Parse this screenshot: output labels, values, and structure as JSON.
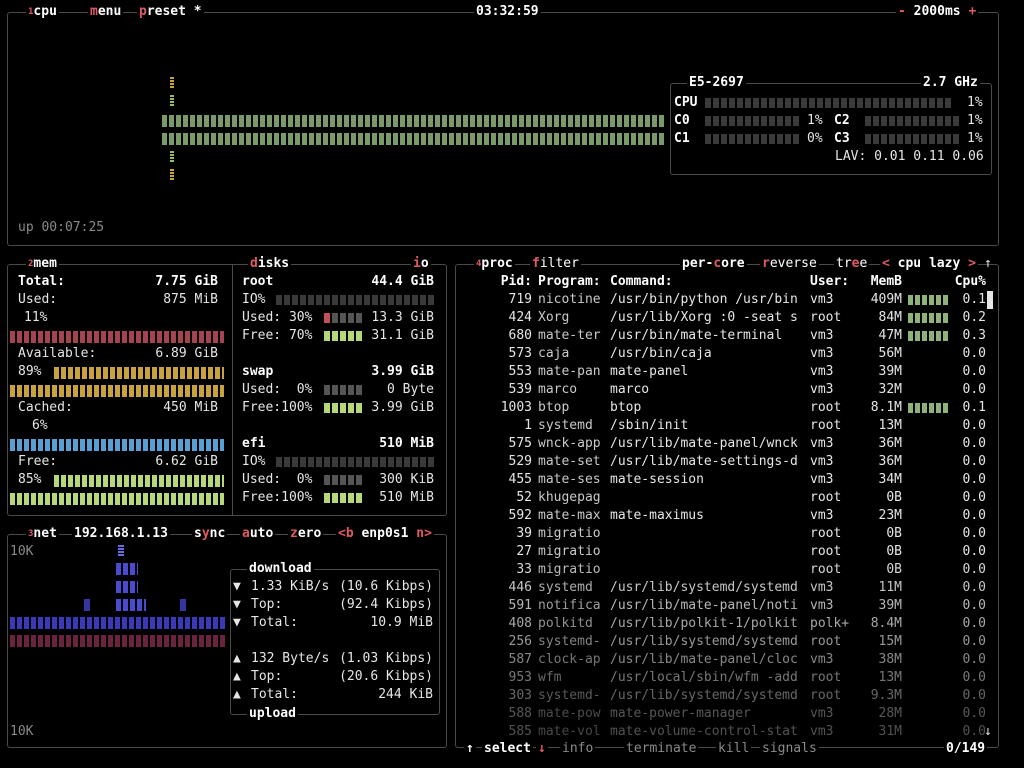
{
  "colors": {
    "accent": "#e05a63",
    "green_dim": "#4c6b3c",
    "green": "#7ab55c",
    "mem_used": "#c0505e",
    "mem_avail": "#c8a23c",
    "mem_cached": "#5a9fd4",
    "mem_free": "#9fd05a",
    "net_dl": "#4b4bd0",
    "net_ul": "#8a2c4a"
  },
  "cpu_box": {
    "title": "cpu",
    "menu": "menu",
    "preset": "preset *",
    "clock": "03:32:59",
    "refresh": "2000ms",
    "minus": "-",
    "plus": "+",
    "uptime": "up 00:07:25",
    "model": "E5-2697",
    "freq": "2.7 GHz",
    "total": {
      "label": "CPU",
      "value": "1%"
    },
    "cores": [
      {
        "label": "C0",
        "value": "1%"
      },
      {
        "label": "C1",
        "value": "0%"
      },
      {
        "label": "C2",
        "value": "1%"
      },
      {
        "label": "C3",
        "value": "1%"
      }
    ],
    "lav_label": "LAV:",
    "lav": "0.01 0.11 0.06",
    "superscript": "1"
  },
  "mem_box": {
    "title": "mem",
    "superscript": "2",
    "total_label": "Total:",
    "total": "7.75 GiB",
    "used_label": "Used:",
    "used": "875 MiB",
    "used_pct": "11%",
    "available_label": "Available:",
    "available": "6.89 GiB",
    "available_pct": "89%",
    "cached_label": "Cached:",
    "cached": "450 MiB",
    "cached_pct": "6%",
    "free_label": "Free:",
    "free": "6.62 GiB",
    "free_pct": "85%",
    "levels": {
      "used": 0.11,
      "available": 0.89,
      "cached": 0.06,
      "free": 0.85
    }
  },
  "disks_box": {
    "title": "disks",
    "io": "io",
    "disks": [
      {
        "name": "root",
        "size": "44.4 GiB",
        "io_label": "IO%",
        "used_label": "Used: 30%",
        "used": "13.3 GiB",
        "free_label": "Free: 70%",
        "free": "31.1 GiB"
      },
      {
        "name": "swap",
        "size": "3.99 GiB",
        "used_label": "Used:  0%",
        "used": "0 Byte",
        "free_label": "Free:100%",
        "free": "3.99 GiB"
      },
      {
        "name": "efi",
        "size": "510 MiB",
        "io_label": "IO%",
        "used_label": "Used:  0%",
        "used": "300 KiB",
        "free_label": "Free:100%",
        "free": "510 MiB"
      }
    ]
  },
  "net_box": {
    "title": "net",
    "superscript": "3",
    "ip": "192.168.1.13",
    "sync": "sync",
    "auto": "auto",
    "zero": "zero",
    "prev": "<b",
    "iface": "enp0s1",
    "next": "n>",
    "scale_top": "10K",
    "scale_bottom": "10K",
    "download_title": "download",
    "upload_title": "upload",
    "download": [
      {
        "label": "1.33 KiB/s",
        "value": "(10.6 Kibps)"
      },
      {
        "label": "Top:",
        "value": "(92.4 Kibps)"
      },
      {
        "label": "Total:",
        "value": "10.9 MiB"
      }
    ],
    "upload": [
      {
        "label": "132 Byte/s",
        "value": "(1.03 Kibps)"
      },
      {
        "label": "Top:",
        "value": "(20.6 Kibps)"
      },
      {
        "label": "Total:",
        "value": "244 KiB"
      }
    ]
  },
  "proc_box": {
    "title": "proc",
    "superscript": "4",
    "filter": "filter",
    "per_core": "per-core",
    "reverse": "reverse",
    "tree": "tree",
    "sort_prev": "<",
    "sort": "cpu lazy",
    "sort_next": ">",
    "headers": {
      "pid": "Pid:",
      "program": "Program:",
      "command": "Command:",
      "user": "User:",
      "mem": "MemB",
      "cpu": "Cpu%"
    },
    "rows": [
      {
        "pid": "719",
        "program": "nicotine",
        "command": "/usr/bin/python /usr/bin",
        "user": "vm3",
        "mem": "409M",
        "cpu": "0.1"
      },
      {
        "pid": "424",
        "program": "Xorg",
        "command": "/usr/lib/Xorg :0 -seat s",
        "user": "root",
        "mem": "84M",
        "cpu": "0.2"
      },
      {
        "pid": "680",
        "program": "mate-ter",
        "command": "/usr/bin/mate-terminal",
        "user": "vm3",
        "mem": "47M",
        "cpu": "0.3"
      },
      {
        "pid": "573",
        "program": "caja",
        "command": "/usr/bin/caja",
        "user": "vm3",
        "mem": "56M",
        "cpu": "0.0"
      },
      {
        "pid": "553",
        "program": "mate-pan",
        "command": "mate-panel",
        "user": "vm3",
        "mem": "39M",
        "cpu": "0.0"
      },
      {
        "pid": "539",
        "program": "marco",
        "command": "marco",
        "user": "vm3",
        "mem": "32M",
        "cpu": "0.0"
      },
      {
        "pid": "1003",
        "program": "btop",
        "command": "btop",
        "user": "root",
        "mem": "8.1M",
        "cpu": "0.1"
      },
      {
        "pid": "1",
        "program": "systemd",
        "command": "/sbin/init",
        "user": "root",
        "mem": "13M",
        "cpu": "0.0"
      },
      {
        "pid": "575",
        "program": "wnck-app",
        "command": "/usr/lib/mate-panel/wnck",
        "user": "vm3",
        "mem": "36M",
        "cpu": "0.0"
      },
      {
        "pid": "529",
        "program": "mate-set",
        "command": "/usr/lib/mate-settings-d",
        "user": "vm3",
        "mem": "36M",
        "cpu": "0.0"
      },
      {
        "pid": "455",
        "program": "mate-ses",
        "command": "mate-session",
        "user": "vm3",
        "mem": "34M",
        "cpu": "0.0"
      },
      {
        "pid": "52",
        "program": "khugepag",
        "command": "",
        "user": "root",
        "mem": "0B",
        "cpu": "0.0"
      },
      {
        "pid": "592",
        "program": "mate-max",
        "command": "mate-maximus",
        "user": "vm3",
        "mem": "23M",
        "cpu": "0.0"
      },
      {
        "pid": "39",
        "program": "migratio",
        "command": "",
        "user": "root",
        "mem": "0B",
        "cpu": "0.0"
      },
      {
        "pid": "27",
        "program": "migratio",
        "command": "",
        "user": "root",
        "mem": "0B",
        "cpu": "0.0"
      },
      {
        "pid": "33",
        "program": "migratio",
        "command": "",
        "user": "root",
        "mem": "0B",
        "cpu": "0.0"
      },
      {
        "pid": "446",
        "program": "systemd",
        "command": "/usr/lib/systemd/systemd",
        "user": "vm3",
        "mem": "11M",
        "cpu": "0.0"
      },
      {
        "pid": "591",
        "program": "notifica",
        "command": "/usr/lib/mate-panel/noti",
        "user": "vm3",
        "mem": "39M",
        "cpu": "0.0"
      },
      {
        "pid": "408",
        "program": "polkitd",
        "command": "/usr/lib/polkit-1/polkit",
        "user": "polk+",
        "mem": "8.4M",
        "cpu": "0.0"
      },
      {
        "pid": "256",
        "program": "systemd-",
        "command": "/usr/lib/systemd/systemd",
        "user": "root",
        "mem": "15M",
        "cpu": "0.0"
      },
      {
        "pid": "587",
        "program": "clock-ap",
        "command": "/usr/lib/mate-panel/cloc",
        "user": "vm3",
        "mem": "38M",
        "cpu": "0.0"
      },
      {
        "pid": "953",
        "program": "wfm",
        "command": "/usr/local/sbin/wfm -add",
        "user": "root",
        "mem": "13M",
        "cpu": "0.0"
      },
      {
        "pid": "303",
        "program": "systemd-",
        "command": "/usr/lib/systemd/systemd",
        "user": "root",
        "mem": "9.3M",
        "cpu": "0.0"
      },
      {
        "pid": "588",
        "program": "mate-pow",
        "command": "mate-power-manager",
        "user": "vm3",
        "mem": "28M",
        "cpu": "0.0"
      },
      {
        "pid": "585",
        "program": "mate-vol",
        "command": "mate-volume-control-stat",
        "user": "vm3",
        "mem": "31M",
        "cpu": "0.0"
      }
    ],
    "footer": {
      "select": "select",
      "info": "info",
      "terminate": "terminate",
      "kill": "kill",
      "signals": "signals",
      "count": "0/149"
    }
  }
}
